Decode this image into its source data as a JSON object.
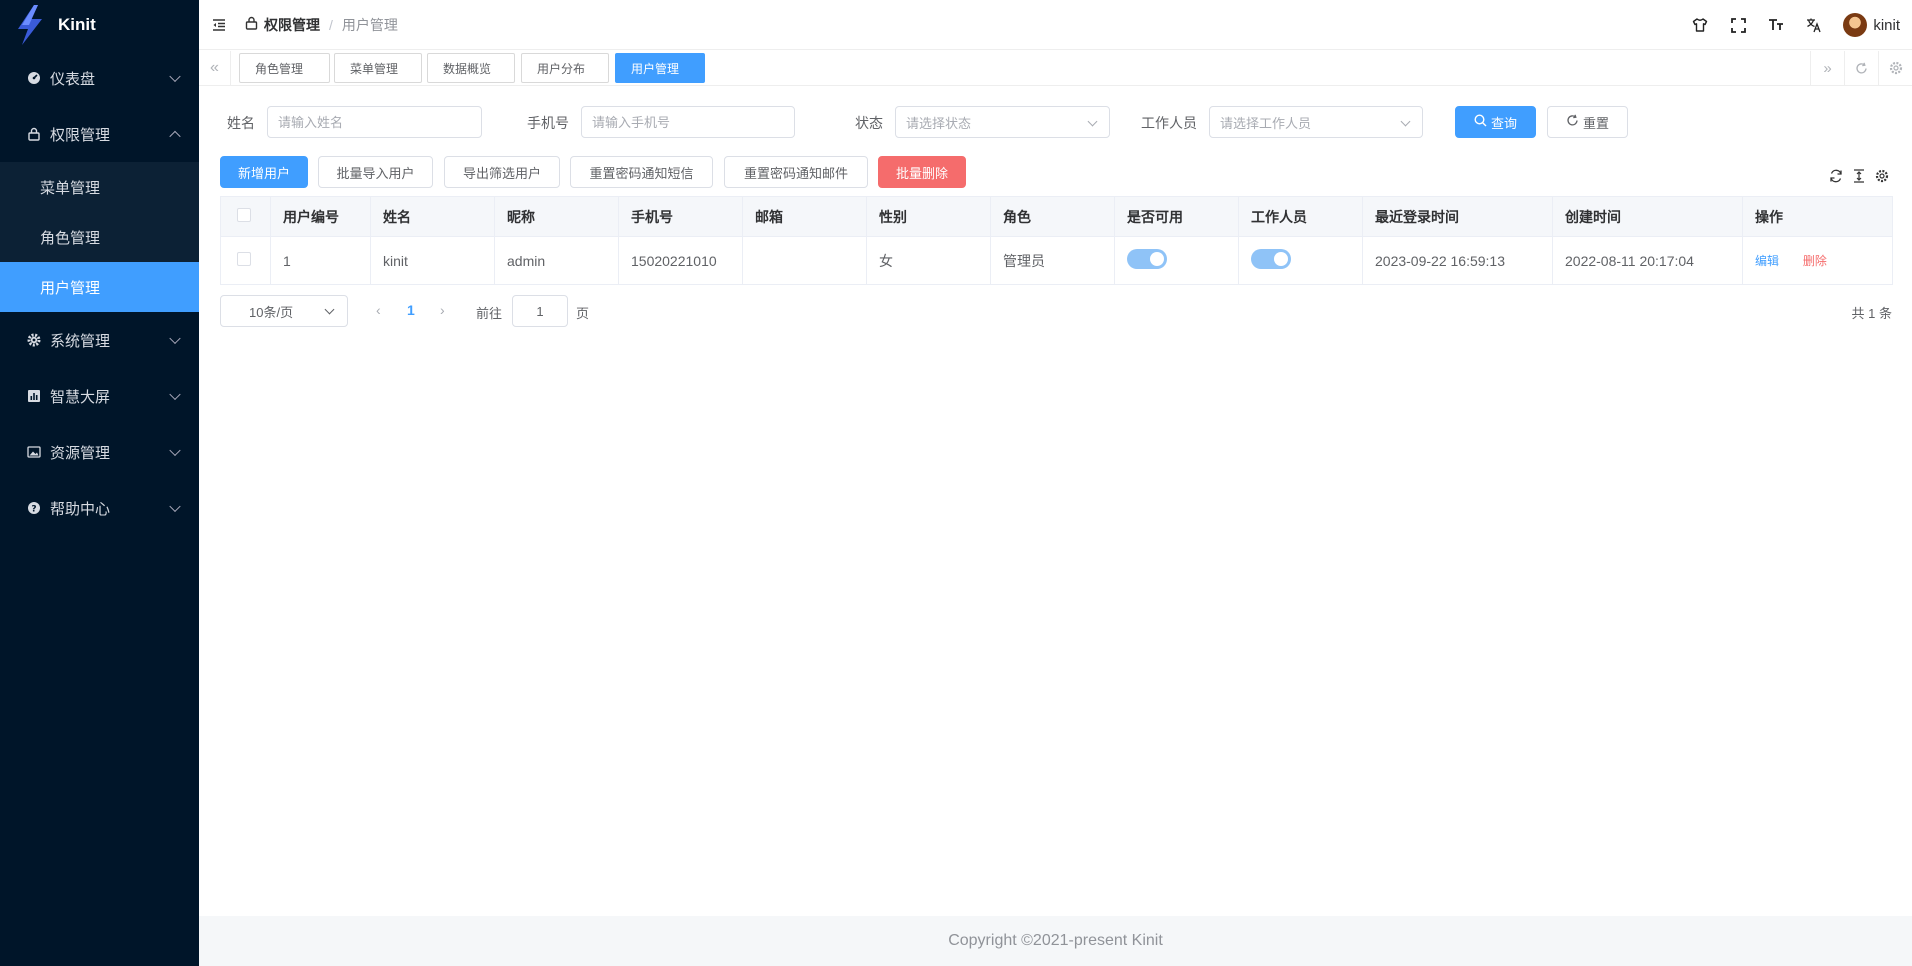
{
  "app": {
    "name": "Kinit"
  },
  "sidebar": {
    "items": [
      {
        "label": "仪表盘",
        "icon": "dashboard-icon",
        "expanded": false
      },
      {
        "label": "权限管理",
        "icon": "lock-icon",
        "expanded": true,
        "children": [
          {
            "label": "菜单管理",
            "active": false
          },
          {
            "label": "角色管理",
            "active": false
          },
          {
            "label": "用户管理",
            "active": true
          }
        ]
      },
      {
        "label": "系统管理",
        "icon": "gear-icon",
        "expanded": false
      },
      {
        "label": "智慧大屏",
        "icon": "chart-icon",
        "expanded": false
      },
      {
        "label": "资源管理",
        "icon": "image-icon",
        "expanded": false
      },
      {
        "label": "帮助中心",
        "icon": "help-icon",
        "expanded": false
      }
    ]
  },
  "header": {
    "breadcrumb": [
      "权限管理",
      "用户管理"
    ],
    "breadcrumb_sep": "/",
    "username": "kinit"
  },
  "tabs": [
    "角色管理",
    "菜单管理",
    "数据概览",
    "用户分布",
    "用户管理"
  ],
  "active_tab": "用户管理",
  "search": {
    "name_label": "姓名",
    "name_placeholder": "请输入姓名",
    "phone_label": "手机号",
    "phone_placeholder": "请输入手机号",
    "status_label": "状态",
    "status_placeholder": "请选择状态",
    "staff_label": "工作人员",
    "staff_placeholder": "请选择工作人员",
    "query_label": "查询",
    "reset_label": "重置"
  },
  "toolbar": {
    "add_user": "新增用户",
    "batch_import": "批量导入用户",
    "export_filtered": "导出筛选用户",
    "reset_pwd_sms": "重置密码通知短信",
    "reset_pwd_email": "重置密码通知邮件",
    "batch_delete": "批量删除"
  },
  "table": {
    "columns": [
      "用户编号",
      "姓名",
      "昵称",
      "手机号",
      "邮箱",
      "性别",
      "角色",
      "是否可用",
      "工作人员",
      "最近登录时间",
      "创建时间",
      "操作"
    ],
    "rows": [
      {
        "id": "1",
        "name": "kinit",
        "nickname": "admin",
        "phone": "15020221010",
        "email": "",
        "gender": "女",
        "role": "管理员",
        "enabled": true,
        "staff": true,
        "last_login": "2023-09-22 16:59:13",
        "created": "2022-08-11 20:17:04"
      }
    ],
    "edit_label": "编辑",
    "delete_label": "删除"
  },
  "pagination": {
    "page_size": "10条/页",
    "current_page": "1",
    "goto_label": "前往",
    "goto_value": "1",
    "page_suffix": "页",
    "total": "共 1 条"
  },
  "colors": {
    "primary": "#409eff",
    "danger": "#f56c6c",
    "sidebar_bg": "#001529"
  },
  "footer": {
    "copyright": "Copyright ©2021-present Kinit"
  }
}
